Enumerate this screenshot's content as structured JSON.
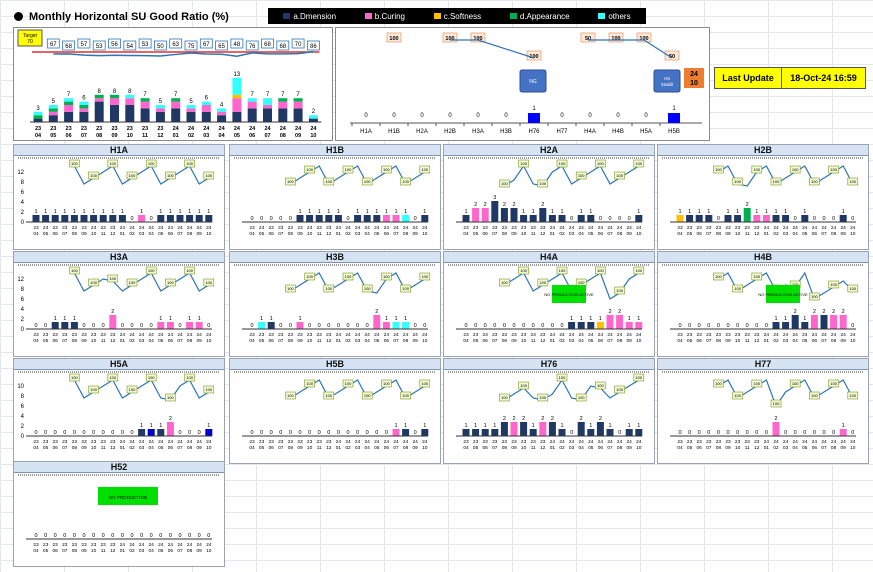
{
  "title": "Monthly Horizontal SU Good Ratio (%)",
  "legend": [
    {
      "label": "a.Dmension",
      "color": "#1f3864"
    },
    {
      "label": "b.Curing",
      "color": "#ff66cc"
    },
    {
      "label": "c.Softness",
      "color": "#ffc000"
    },
    {
      "label": "d.Appearance",
      "color": "#00b050"
    },
    {
      "label": "others",
      "color": "#33ffff"
    }
  ],
  "last_update": {
    "label": "Last Update",
    "value": "18-Oct-24 16:59"
  },
  "months_x": [
    "23 04",
    "23 05",
    "23 06",
    "23 07",
    "23 08",
    "23 09",
    "23 10",
    "23 11",
    "23 12",
    "24 01",
    "24 02",
    "24 03",
    "24 04",
    "24 05",
    "24 06",
    "24 07",
    "24 08",
    "24 09",
    "24 10"
  ],
  "months_x_short": [
    "24 01",
    "24 02",
    "24 03",
    "24 04",
    "24 05",
    "24 06",
    "24 07",
    "24 08",
    "24 09",
    "24 10"
  ],
  "main_chart": {
    "target_label": "Target 70",
    "ratio": [
      null,
      67,
      68,
      57,
      53,
      56,
      54,
      53,
      50,
      63,
      75,
      67,
      65,
      48,
      76,
      68,
      68,
      70,
      86
    ],
    "counts": [
      3,
      5,
      7,
      6,
      8,
      8,
      8,
      7,
      5,
      7,
      5,
      6,
      4,
      13,
      7,
      7,
      7,
      7,
      2
    ],
    "stack": [
      [
        1,
        0,
        0,
        1,
        0,
        1
      ],
      [
        2,
        1,
        0,
        1,
        0,
        1
      ],
      [
        3,
        2,
        0,
        1,
        0,
        1
      ],
      [
        3,
        1,
        0,
        1,
        0,
        1
      ],
      [
        6,
        1,
        0,
        1,
        0,
        0
      ],
      [
        5,
        2,
        0,
        1,
        0,
        0
      ],
      [
        5,
        2,
        0,
        0,
        0,
        1
      ],
      [
        4,
        2,
        0,
        1,
        0,
        0
      ],
      [
        3,
        1,
        0,
        0,
        0,
        1
      ],
      [
        4,
        2,
        0,
        1,
        0,
        0
      ],
      [
        3,
        1,
        0,
        0,
        0,
        1
      ],
      [
        3,
        2,
        0,
        0,
        0,
        1
      ],
      [
        2,
        1,
        0,
        0,
        0,
        1
      ],
      [
        3,
        4,
        1,
        0,
        0,
        5
      ],
      [
        4,
        2,
        0,
        0,
        0,
        1
      ],
      [
        4,
        1,
        0,
        0,
        0,
        2
      ],
      [
        4,
        2,
        0,
        1,
        0,
        0
      ],
      [
        4,
        2,
        0,
        1,
        0,
        0
      ],
      [
        1,
        0,
        0,
        0,
        0,
        1
      ]
    ]
  },
  "line_summary": {
    "lines": [
      "H1A",
      "H1B",
      "H2A",
      "H2B",
      "H3A",
      "H3B",
      "H76",
      "H77",
      "H4A",
      "H4B",
      "H5A",
      "H5B"
    ],
    "values": [
      0,
      0,
      0,
      0,
      0,
      0,
      1,
      0,
      0,
      0,
      0,
      1
    ],
    "top_tags": [
      "100",
      "100",
      "100",
      "100",
      "50",
      "100",
      "100",
      "50"
    ],
    "callout_1": "NG",
    "callout_2": "H5 Stabill",
    "badge": "24 10"
  },
  "panels": [
    {
      "name": "H1A",
      "x": [
        "24 01",
        "24 02",
        "24 03",
        "24 04",
        "24 05",
        "24 06",
        "24 07",
        "24 08",
        "24 09",
        "24 10"
      ],
      "counts": [
        1,
        1,
        1,
        1,
        1,
        1,
        1,
        1,
        1,
        1,
        0,
        1,
        0,
        1,
        1,
        1,
        1,
        1,
        1
      ],
      "colors": [
        "d",
        "d",
        "d",
        "d",
        "d",
        "d",
        "d",
        "d",
        "d",
        "d",
        "p",
        "p",
        "d",
        "d",
        "d",
        "d",
        "d",
        "d",
        "d"
      ]
    },
    {
      "name": "H1B",
      "counts": [
        0,
        0,
        0,
        0,
        0,
        1,
        1,
        1,
        1,
        1,
        0,
        1,
        1,
        1,
        1,
        1,
        1,
        0,
        1
      ],
      "colors": [
        "d",
        "d",
        "d",
        "d",
        "d",
        "d",
        "d",
        "d",
        "d",
        "d",
        "d",
        "d",
        "d",
        "d",
        "p",
        "p",
        "c",
        "d",
        "d"
      ]
    },
    {
      "name": "H2A",
      "counts": [
        1,
        2,
        2,
        3,
        2,
        2,
        1,
        1,
        2,
        1,
        1,
        0,
        1,
        1,
        0,
        0,
        0,
        0,
        1
      ],
      "colors": [
        "d",
        "p",
        "p",
        "d",
        "d",
        "d",
        "d",
        "d",
        "d",
        "d",
        "d",
        "c",
        "d",
        "d",
        "d",
        "d",
        "d",
        "d",
        "d"
      ]
    },
    {
      "name": "H2B",
      "counts": [
        1,
        1,
        1,
        1,
        0,
        1,
        1,
        2,
        1,
        1,
        1,
        1,
        0,
        1,
        0,
        0,
        0,
        1,
        0
      ],
      "colors": [
        "y",
        "d",
        "d",
        "d",
        "d",
        "d",
        "d",
        "g",
        "p",
        "p",
        "d",
        "d",
        "d",
        "d",
        "d",
        "d",
        "d",
        "d",
        "d"
      ]
    },
    {
      "name": "H3A",
      "counts": [
        0,
        0,
        1,
        1,
        1,
        0,
        0,
        0,
        2,
        0,
        0,
        0,
        0,
        1,
        1,
        0,
        1,
        1,
        0
      ],
      "colors": [
        "d",
        "d",
        "d",
        "d",
        "d",
        "d",
        "d",
        "d",
        "p",
        "d",
        "d",
        "d",
        "d",
        "p",
        "p",
        "c",
        "p",
        "p",
        "d"
      ]
    },
    {
      "name": "H3B",
      "counts": [
        0,
        1,
        1,
        0,
        0,
        1,
        0,
        0,
        0,
        0,
        0,
        0,
        0,
        2,
        1,
        1,
        1,
        0,
        0
      ],
      "colors": [
        "d",
        "c",
        "d",
        "d",
        "d",
        "p",
        "d",
        "d",
        "d",
        "d",
        "d",
        "d",
        "d",
        "p",
        "p",
        "c",
        "c",
        "d",
        "d"
      ]
    },
    {
      "name": "H4A",
      "counts": [
        0,
        0,
        0,
        0,
        0,
        0,
        0,
        0,
        0,
        0,
        0,
        1,
        1,
        1,
        1,
        2,
        2,
        1,
        1
      ],
      "colors": [
        "d",
        "d",
        "d",
        "d",
        "d",
        "d",
        "d",
        "d",
        "d",
        "d",
        "d",
        "d",
        "d",
        "d",
        "y",
        "p",
        "p",
        "p",
        "p"
      ]
    },
    {
      "name": "H4B",
      "counts": [
        0,
        0,
        0,
        0,
        0,
        0,
        0,
        0,
        0,
        0,
        1,
        1,
        2,
        1,
        2,
        2,
        2,
        2,
        0
      ],
      "colors": [
        "d",
        "d",
        "d",
        "d",
        "d",
        "d",
        "d",
        "d",
        "d",
        "d",
        "d",
        "d",
        "d",
        "d",
        "p",
        "d",
        "p",
        "p",
        "d"
      ]
    },
    {
      "name": "H5A",
      "counts": [
        0,
        0,
        0,
        0,
        0,
        0,
        0,
        0,
        0,
        0,
        0,
        1,
        1,
        1,
        2,
        0,
        0,
        0,
        1
      ],
      "colors": [
        "d",
        "d",
        "d",
        "d",
        "d",
        "d",
        "d",
        "d",
        "d",
        "d",
        "d",
        "d",
        "b",
        "d",
        "p",
        "d",
        "d",
        "d",
        "b"
      ]
    },
    {
      "name": "H5B",
      "counts": [
        0,
        0,
        0,
        0,
        0,
        0,
        0,
        0,
        0,
        0,
        0,
        0,
        0,
        0,
        0,
        1,
        1,
        0,
        1
      ],
      "colors": [
        "d",
        "d",
        "d",
        "d",
        "d",
        "d",
        "d",
        "d",
        "d",
        "d",
        "d",
        "d",
        "d",
        "d",
        "d",
        "p",
        "d",
        "d",
        "d"
      ]
    },
    {
      "name": "H76",
      "counts": [
        1,
        1,
        1,
        1,
        2,
        2,
        2,
        1,
        2,
        2,
        1,
        0,
        2,
        1,
        2,
        1,
        0,
        1,
        1
      ],
      "colors": [
        "d",
        "d",
        "d",
        "d",
        "d",
        "p",
        "d",
        "d",
        "p",
        "d",
        "d",
        "d",
        "d",
        "d",
        "d",
        "d",
        "d",
        "d",
        "d"
      ]
    },
    {
      "name": "H77",
      "counts": [
        0,
        0,
        0,
        0,
        0,
        0,
        0,
        0,
        0,
        0,
        2,
        0,
        0,
        0,
        0,
        0,
        0,
        1,
        0
      ],
      "colors": [
        "d",
        "d",
        "d",
        "d",
        "d",
        "d",
        "d",
        "d",
        "d",
        "d",
        "p",
        "d",
        "d",
        "d",
        "d",
        "d",
        "d",
        "p",
        "d"
      ]
    },
    {
      "name": "H52",
      "counts": [
        0,
        0,
        0,
        0,
        0,
        0,
        0,
        0,
        0,
        0,
        0,
        0,
        0,
        0,
        0,
        0,
        0,
        0,
        0
      ],
      "colors": [],
      "note": "NO PRODUCTION"
    }
  ],
  "panel_notes": {
    "H4A": "NO PRODUCTION ACTIVE",
    "H4B": "NO PRODUCTION ACTIVE"
  },
  "y_ticks_small": [
    "12",
    "8",
    "6",
    "4",
    "2",
    "0"
  ]
}
